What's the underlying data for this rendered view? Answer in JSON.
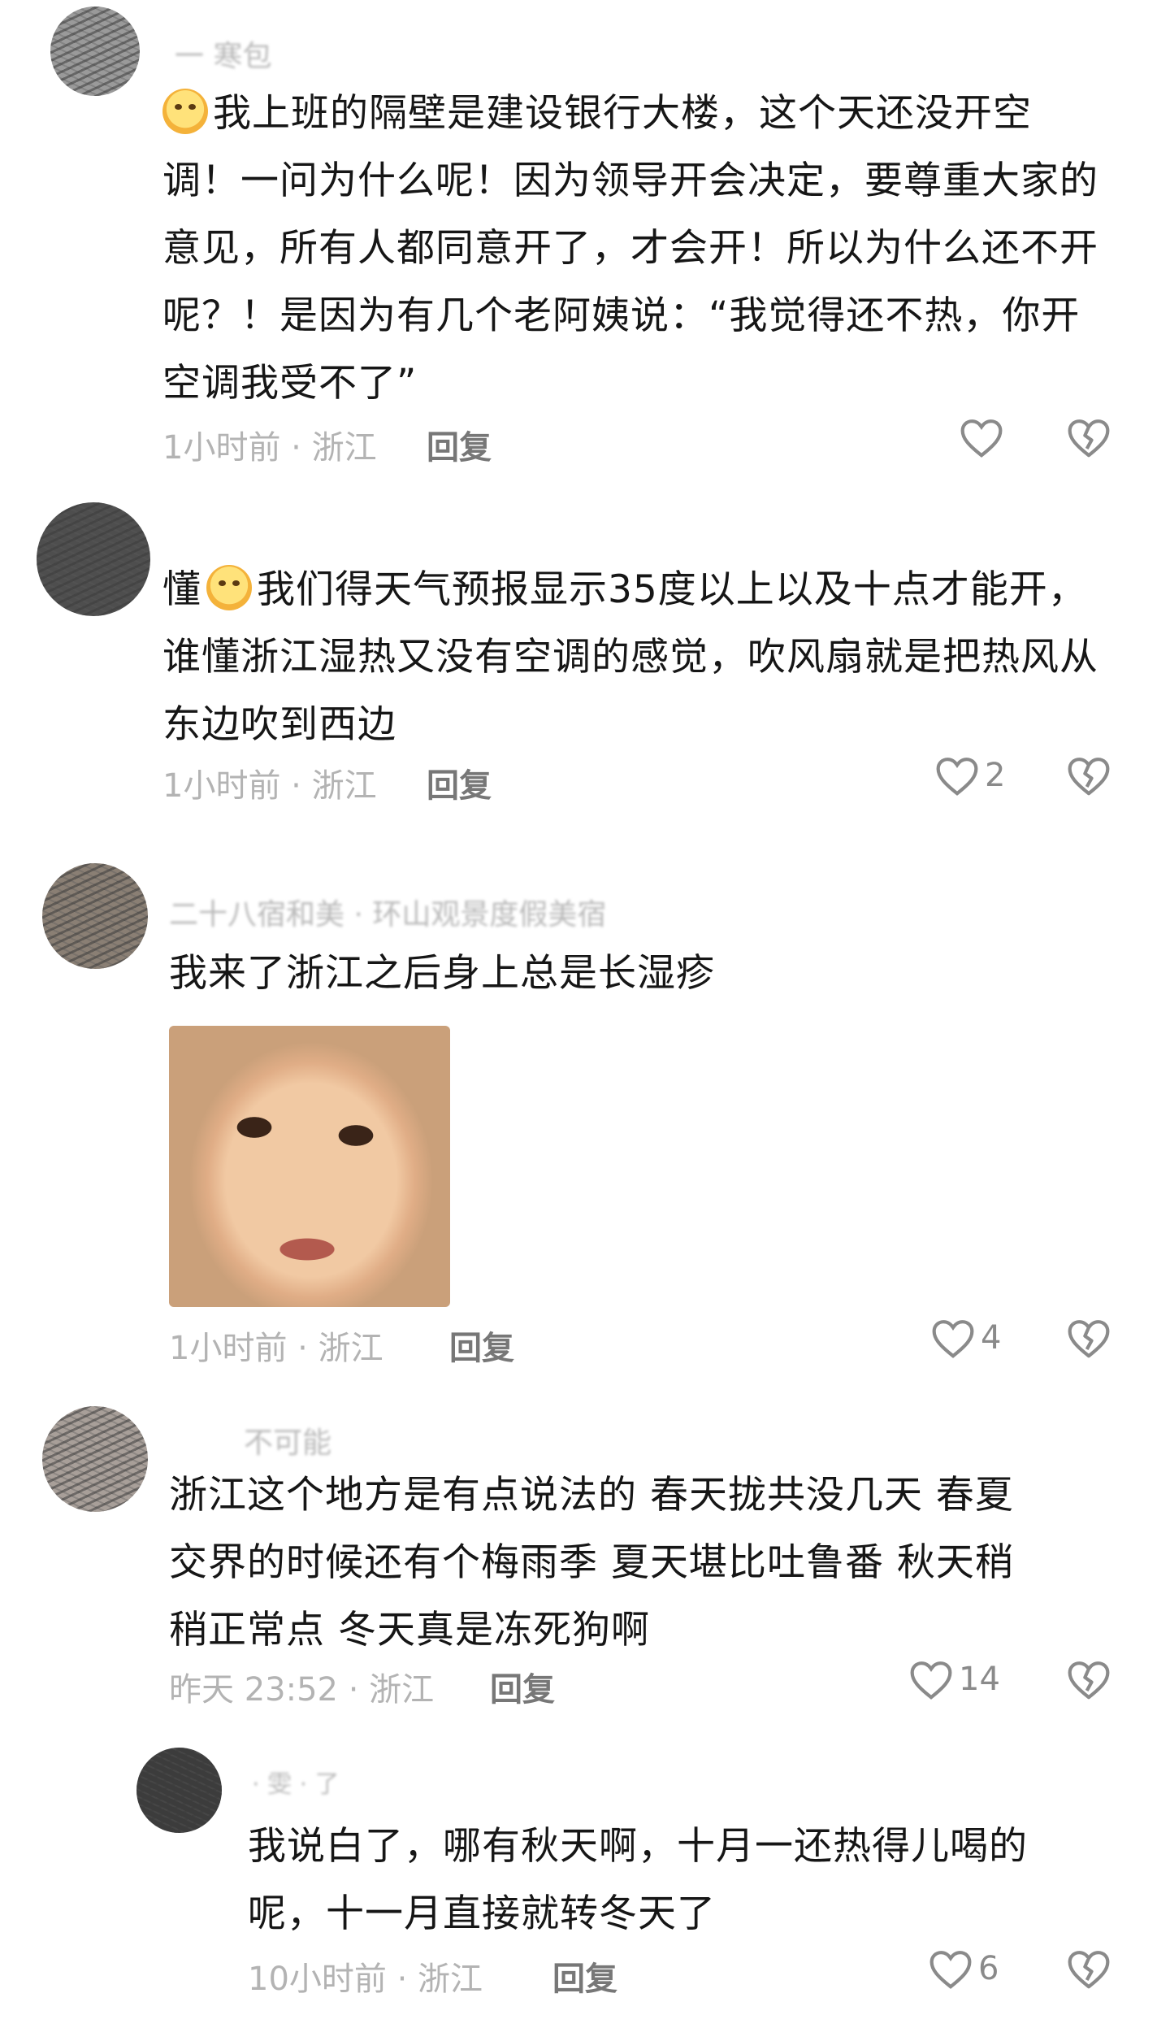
{
  "comments": [
    {
      "username": "一 寒包",
      "text": "我上班的隔壁是建设银行大楼，这个天还没开空调！一问为什么呢！因为领导开会决定，要尊重大家的意见，所有人都同意开了，才会开！所以为什么还不开呢？！是因为有几个老阿姨说：“我觉得还不热，你开空调我受不了”",
      "lines": [
        "我上班的隔壁是建设银行大楼，这个天还没开空",
        "调！一问为什么呢！因为领导开会决定，要尊重大家的",
        "意见，所有人都同意开了，才会开！所以为什么还不开",
        "呢？！是因为有几个老阿姨说：“我觉得还不热，你开",
        "空调我受不了”"
      ],
      "emoji": "sweat-emoji",
      "meta": "1小时前 · 浙江",
      "reply": "回复",
      "likes": ""
    },
    {
      "username": "",
      "lines": [
        "懂",
        "我们得天气预报显示35度以上以及十点才能开，",
        "谁懂浙江湿热又没有空调的感觉，吹风扇就是把热风从",
        "东边吹到西边"
      ],
      "emoji": "smile-emoji",
      "meta": "1小时前 · 浙江",
      "reply": "回复",
      "likes": "2"
    },
    {
      "username": "二十八宿和美 · 环山观景度假美宿",
      "lines": [
        "我来了浙江之后身上总是长湿疹"
      ],
      "image": "crying-child-face-photo",
      "meta": "1小时前 · 浙江",
      "reply": "回复",
      "likes": "4"
    },
    {
      "username": "不可能",
      "lines": [
        "浙江这个地方是有点说法的 春天拢共没几天 春夏",
        "交界的时候还有个梅雨季 夏天堪比吐鲁番 秋天稍",
        "稍正常点 冬天真是冻死狗啊"
      ],
      "meta": "昨天 23:52 · 浙江",
      "reply": "回复",
      "likes": "14"
    },
    {
      "username": "· 雯 · 了",
      "lines": [
        "我说白了，哪有秋天啊，十月一还热得儿喝的",
        "呢，十一月直接就转冬天了"
      ],
      "meta": "10小时前 · 浙江",
      "reply": "回复",
      "likes": "6"
    }
  ],
  "icons": {
    "like": "heart-outline-icon",
    "dislike": "broken-heart-icon"
  },
  "colors": {
    "text": "#161616",
    "meta": "#b3b3b3",
    "reply": "#777777",
    "icon": "#8a8a8a"
  }
}
